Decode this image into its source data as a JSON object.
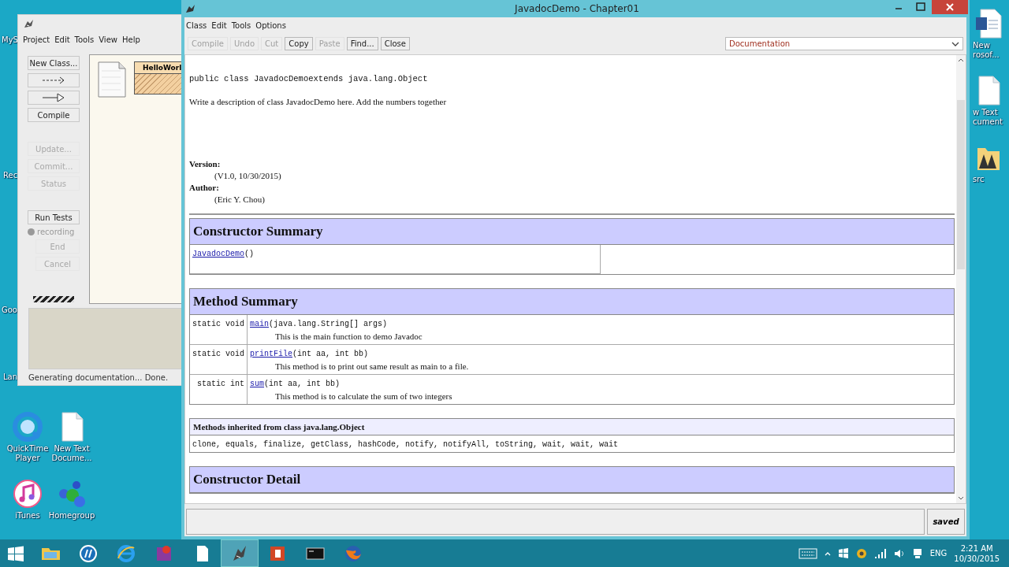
{
  "desktop": {
    "icons": [
      {
        "label": "MyS",
        "kind": "cut"
      },
      {
        "label": "Rec",
        "kind": "cut"
      },
      {
        "label": "Goo",
        "kind": "cut"
      },
      {
        "label": "Lan",
        "kind": "cut"
      },
      {
        "label": "QuickTime Player",
        "kind": "quicktime"
      },
      {
        "label": "New Text Docume...",
        "kind": "textdoc"
      },
      {
        "label": "iTunes",
        "kind": "itunes"
      },
      {
        "label": "Homegroup",
        "kind": "homegroup"
      },
      {
        "label": "New\nrosof...",
        "kind": "worddoc"
      },
      {
        "label": "w Text\ncument",
        "kind": "textdoc"
      },
      {
        "label": "src",
        "kind": "folder"
      }
    ]
  },
  "bluej": {
    "menu": [
      "Project",
      "Edit",
      "Tools",
      "View",
      "Help"
    ],
    "tool_buttons": [
      {
        "kind": "text",
        "label": "New Class...",
        "disabled": false
      },
      {
        "kind": "uses-arrow",
        "disabled": false
      },
      {
        "kind": "extends-arrow",
        "disabled": false
      },
      {
        "kind": "text",
        "label": "Compile",
        "disabled": false
      }
    ],
    "team_buttons": [
      {
        "label": "Update...",
        "disabled": true
      },
      {
        "label": "Commit...",
        "disabled": true
      },
      {
        "label": "Status",
        "disabled": true
      }
    ],
    "run_tests": {
      "label": "Run Tests",
      "disabled": false
    },
    "recording": {
      "label": "recording",
      "on": false
    },
    "record_buttons": [
      {
        "label": "End",
        "disabled": true
      },
      {
        "label": "Cancel",
        "disabled": true
      }
    ],
    "classes": [
      {
        "name": "HelloWorl"
      }
    ],
    "status": "Generating documentation... Done."
  },
  "editor": {
    "title": "JavadocDemo - Chapter01",
    "menu": [
      "Class",
      "Edit",
      "Tools",
      "Options"
    ],
    "toolbar": [
      {
        "label": "Compile",
        "disabled": true
      },
      {
        "label": "Undo",
        "disabled": true
      },
      {
        "label": "Cut",
        "disabled": true
      },
      {
        "label": "Copy",
        "disabled": false
      },
      {
        "label": "Paste",
        "disabled": true
      },
      {
        "label": "Find...",
        "disabled": false
      },
      {
        "label": "Close",
        "disabled": false
      }
    ],
    "view_selector": {
      "value": "Documentation"
    },
    "doc": {
      "declaration": "public class JavadocDemoextends java.lang.Object",
      "description": "Write a description of class JavadocDemo here. Add the numbers together",
      "tags": [
        {
          "label": "Version:",
          "value": "(V1.0, 10/30/2015)"
        },
        {
          "label": "Author:",
          "value": "(Eric Y. Chou)"
        }
      ],
      "constructor_summary": {
        "title": "Constructor Summary",
        "rows": [
          {
            "link": "JavadocDemo",
            "signature": "()"
          }
        ]
      },
      "method_summary": {
        "title": "Method Summary",
        "rows": [
          {
            "modifier": "static void",
            "link": "main",
            "signature": "(java.lang.String[] args)",
            "description": "This is the main function to demo Javadoc"
          },
          {
            "modifier": "static void",
            "link": "printFile",
            "signature": "(int aa, int bb)",
            "description": "This method is to print out same result as main to a file."
          },
          {
            "modifier": "static int",
            "link": "sum",
            "signature": "(int aa, int bb)",
            "description": "This method is to calculate the sum of two integers"
          }
        ]
      },
      "inherited": {
        "title": "Methods inherited from class java.lang.Object",
        "methods": "clone, equals, finalize, getClass, hashCode, notify, notifyAll, toString, wait, wait, wait"
      },
      "constructor_detail": {
        "title": "Constructor Detail"
      }
    },
    "status": "saved"
  },
  "taskbar": {
    "apps": [
      {
        "kind": "explorer",
        "active": false
      },
      {
        "kind": "hp",
        "active": false
      },
      {
        "kind": "ie",
        "active": false
      },
      {
        "kind": "app",
        "active": false
      },
      {
        "kind": "notepad",
        "active": false
      },
      {
        "kind": "bluej",
        "active": true
      },
      {
        "kind": "powerpoint",
        "active": false
      },
      {
        "kind": "cmd",
        "active": false
      },
      {
        "kind": "firefox",
        "active": false
      }
    ],
    "language": "ENG",
    "time": "2:21 AM",
    "date": "10/30/2015"
  }
}
